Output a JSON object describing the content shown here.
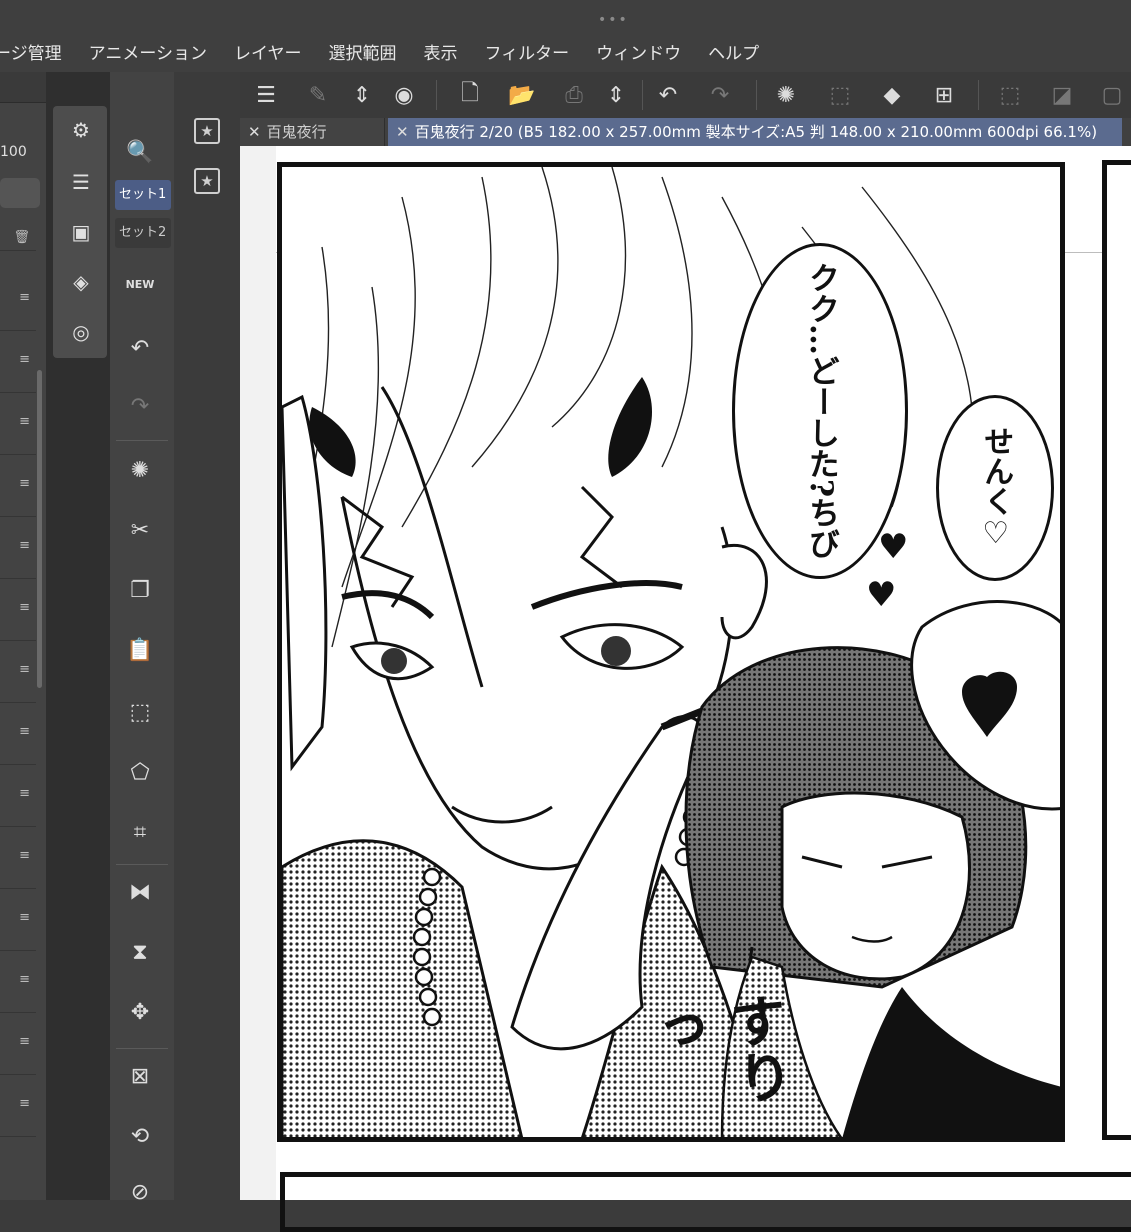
{
  "window": {
    "grip": "•••"
  },
  "menubar": {
    "items": [
      "ージ管理",
      "アニメーション",
      "レイヤー",
      "選択範囲",
      "表示",
      "フィルター",
      "ウィンドウ",
      "ヘルプ"
    ]
  },
  "left_panel": {
    "zoom_value": "100"
  },
  "command_bar": {
    "set1_label": "セット1",
    "set2_label": "セット2",
    "new_badge": "NEW"
  },
  "tabs": [
    {
      "label": "百鬼夜行"
    },
    {
      "label": "百鬼夜行 2/20 (B5 182.00 x 257.00mm 製本サイズ:A5 判 148.00 x 210.00mm 600dpi 66.1%)"
    }
  ],
  "manga": {
    "bubble1": "クク…どーした?ちび",
    "bubble2": "せんく♡",
    "sfx": "すりっ",
    "heart": "♥"
  }
}
